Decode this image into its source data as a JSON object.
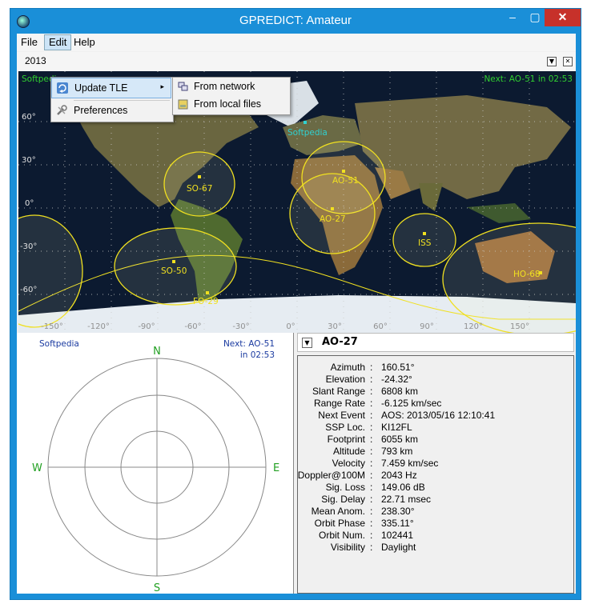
{
  "window": {
    "title": "GPREDICT: Amateur",
    "minimize": "–",
    "maximize": "▢",
    "close": "✕"
  },
  "menubar": {
    "file": "File",
    "edit": "Edit",
    "help": "Help"
  },
  "tab": {
    "text": "2013",
    "dropdown_btn": "▼",
    "close_btn": "✕"
  },
  "edit_menu": {
    "update_tle": "Update TLE",
    "preferences": "Preferences",
    "submenu_arrow": "▸"
  },
  "update_submenu": {
    "from_network": "From network",
    "from_local": "From local files"
  },
  "map": {
    "left_label": "Softpedia",
    "next_event": "Next: AO-51  in 02:53",
    "city_label": "Softpedia",
    "lat_labels": [
      "60°",
      "30°",
      "0°",
      "-30°",
      "-60°"
    ],
    "lon_labels": [
      "-150°",
      "-120°",
      "-90°",
      "-60°",
      "-30°",
      "0°",
      "30°",
      "60°",
      "90°",
      "120°",
      "150°"
    ],
    "satellites": [
      "SO-67",
      "AO-51",
      "AO-27",
      "ISS",
      "SO-50",
      "FO-29",
      "HO-68"
    ],
    "colors": {
      "ocean": "#0c1a30",
      "land": "#6b6a3f",
      "ice": "#e6ecf2",
      "footprint": "#f0e020",
      "grid": "#c8c8c8",
      "label_green": "#30d030"
    }
  },
  "polar": {
    "left_label": "Softpedia",
    "next_line1": "Next: AO-51",
    "next_line2": "in 02:53",
    "north": "N",
    "south": "S",
    "east": "E",
    "west": "W"
  },
  "details": {
    "toggle": "▼",
    "sat_name": "AO-27",
    "rows": [
      {
        "label": "Azimuth",
        "value": "160.51°"
      },
      {
        "label": "Elevation",
        "value": "-24.32°"
      },
      {
        "label": "Slant Range",
        "value": "6808 km"
      },
      {
        "label": "Range Rate",
        "value": "-6.125 km/sec"
      },
      {
        "label": "Next Event",
        "value": "AOS: 2013/05/16 12:10:41"
      },
      {
        "label": "SSP Loc.",
        "value": "KI12FL"
      },
      {
        "label": "Footprint",
        "value": "6055 km"
      },
      {
        "label": "Altitude",
        "value": "793 km"
      },
      {
        "label": "Velocity",
        "value": "7.459 km/sec"
      },
      {
        "label": "Doppler@100M",
        "value": "2043 Hz"
      },
      {
        "label": "Sig. Loss",
        "value": "149.06 dB"
      },
      {
        "label": "Sig. Delay",
        "value": "22.71 msec"
      },
      {
        "label": "Mean Anom.",
        "value": "238.30°"
      },
      {
        "label": "Orbit Phase",
        "value": "335.11°"
      },
      {
        "label": "Orbit Num.",
        "value": "102441"
      },
      {
        "label": "Visibility",
        "value": "Daylight"
      }
    ],
    "separator": ":"
  }
}
